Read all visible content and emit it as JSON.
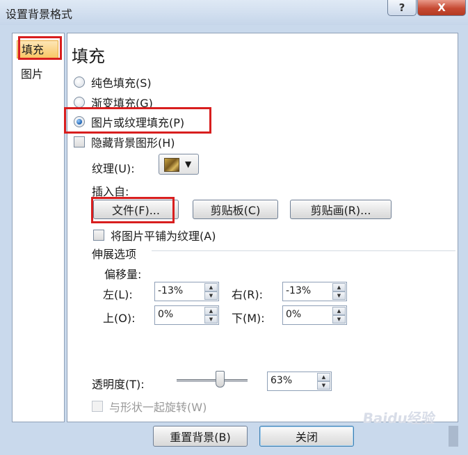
{
  "window": {
    "title": "设置背景格式",
    "help_icon": "?",
    "close_icon": "X"
  },
  "nav": {
    "items": [
      {
        "label": "填充",
        "selected": true
      },
      {
        "label": "图片",
        "selected": false
      }
    ]
  },
  "fill": {
    "section_title": "填充",
    "options": [
      {
        "label": "纯色填充(S)",
        "checked": false
      },
      {
        "label": "渐变填充(G)",
        "checked": false
      },
      {
        "label": "图片或纹理填充(P)",
        "checked": true
      }
    ],
    "hide_background_label": "隐藏背景图形(H)",
    "texture_label": "纹理(U):",
    "insert_from_label": "插入自:",
    "file_button": "文件(F)...",
    "clipboard_button": "剪贴板(C)",
    "clipart_button": "剪贴画(R)...",
    "tile_label": "将图片平铺为纹理(A)",
    "stretch_label": "伸展选项",
    "offset_label": "偏移量:",
    "left_label": "左(L):",
    "left_value": "-13%",
    "right_label": "右(R):",
    "right_value": "-13%",
    "top_label": "上(O):",
    "top_value": "0%",
    "bottom_label": "下(M):",
    "bottom_value": "0%",
    "transparency_label": "透明度(T):",
    "transparency_value": "63%",
    "transparency_fraction": 0.63,
    "rotate_label": "与形状一起旋转(W)"
  },
  "footer": {
    "reset_button": "重置背景(B)",
    "close_button": "关闭",
    "watermark": "Baidu经验"
  },
  "colors": {
    "highlight_red": "#d81e1e",
    "nav_selected": "#f8c766"
  }
}
